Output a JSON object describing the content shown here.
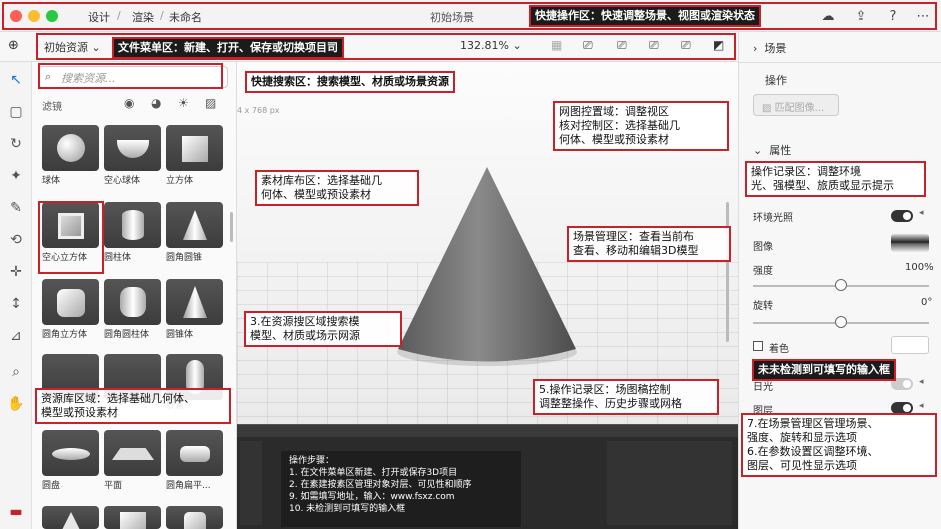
{
  "titlebar": {
    "breadcrumb": [
      "设计",
      "渲染",
      "未命名"
    ],
    "title": "初始场景",
    "icons": [
      "cloud-icon",
      "share-icon",
      "help-icon",
      "more-icon"
    ]
  },
  "toolbar": {
    "file_menu": "初始资源",
    "zoom": "132.81%",
    "view_icons": [
      "frame-icon",
      "camera-icon",
      "camera-icon",
      "camera-icon",
      "render-icon"
    ]
  },
  "left_tools": [
    "add-icon",
    "select-icon",
    "frame-icon",
    "rotate-icon",
    "magic-icon",
    "eyedropper-icon",
    "link-icon",
    "move-icon",
    "height-icon",
    "perspective-icon",
    "zoom-icon",
    "hand-icon",
    "layer-icon"
  ],
  "library": {
    "search_placeholder": "搜索资源...",
    "filter_label": "滤镜",
    "assets": [
      "球体",
      "空心球体",
      "立方体",
      "空心立方体",
      "圆柱体",
      "圆角圆锥",
      "圆角立方体",
      "圆角圆柱体",
      "圆锥体",
      "",
      "",
      "胶囊",
      "圆盘",
      "平面",
      "圆角扁平..."
    ]
  },
  "viewport": {
    "size_label": "4 x 768 px"
  },
  "right_panel": {
    "scene_header": "场景",
    "operation_header": "操作",
    "match_image": "匹配图像...",
    "properties_header": "属性",
    "env_light": "环境光照",
    "image_label": "图像",
    "intensity_label": "强度",
    "intensity_value": "100%",
    "rotation_label": "旋转",
    "rotation_value": "0°",
    "tint_label": "着色",
    "shadow_label": "日光",
    "layers_label": "图层",
    "intensity_level": 0.5,
    "rotation_level": 0.5
  },
  "annotations": {
    "quick_ops": "快捷操作区：快速调整场景、视图或渲染状态",
    "file_menu": "文件菜单区：新建、打开、保存或切换项目司",
    "quick_search": "快捷搜索区：搜索模型、材质或场景资源",
    "viewport_ctrl": "网图控置域：调整视区\n核对控制区：选择基础几\n何体、模型或预设素材",
    "asset_layout": "素材库布区：选择基础几\n何体、模型或预设素材",
    "scene_mgr": "场景管理区：查看当前布\n查看、移动和编辑3D模型",
    "op_record": "操作记录区：调整环境\n光、强模型、旅质或显示提示",
    "step3": "3.在资源搜区域搜索模\n模型、材质或场示网源",
    "asset_lib": "资源库区域：选择基础几何体、\n模型或预设素材",
    "step5": "5.操作记录区：场图稿控制\n调整整操作、历史步骤或网格",
    "no_input": "未未检测到可填写的输入框",
    "step7": "7.在场景管理区管理场景、\n强度、旋转和显示选项\n6.在参数设置区调整环境、\n图层、可见性显示选项"
  },
  "inset": {
    "title": "操作步骤：",
    "steps": [
      "1. 在文件菜单区新建、打开或保存3D项目",
      "2. 在素建按素区管理对象对层、可见性和顺序",
      "9. 如需填写地址，输入：www.fsxz.com",
      "10. 未检测到可填写的输入框"
    ]
  },
  "colors": {
    "accent": "#c8212a",
    "dark": "#1b1b1b"
  }
}
